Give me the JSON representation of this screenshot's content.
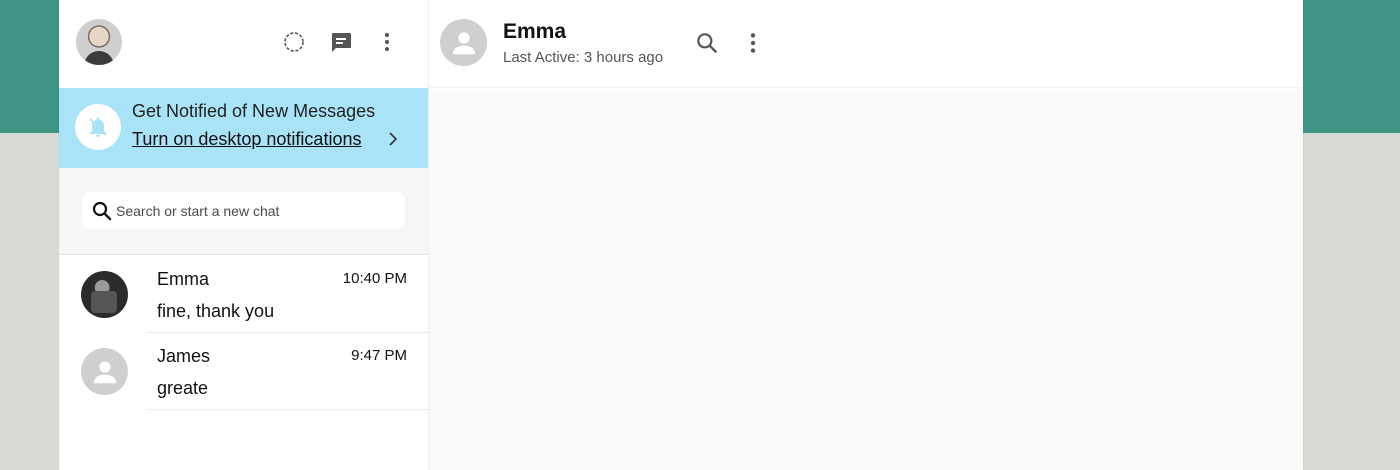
{
  "colors": {
    "top_band": "#3f9484",
    "notification_bg": "#a9e3f8",
    "search_area_bg": "#f5f6f6"
  },
  "sidebar": {
    "header": {
      "icons": [
        "status-icon",
        "new-chat-icon",
        "more-vert-icon"
      ]
    },
    "notification": {
      "title": "Get Notified of New Messages",
      "link": "Turn on desktop notifications",
      "icon": "bell-off-icon"
    },
    "search": {
      "placeholder": "Search or start a new chat",
      "value": ""
    },
    "chats": [
      {
        "name": "Emma",
        "time": "10:40 PM",
        "preview": "fine, thank you"
      },
      {
        "name": "James",
        "time": "9:47 PM",
        "preview": "greate"
      }
    ]
  },
  "conversation": {
    "name": "Emma",
    "status": "Last Active: 3 hours ago"
  }
}
